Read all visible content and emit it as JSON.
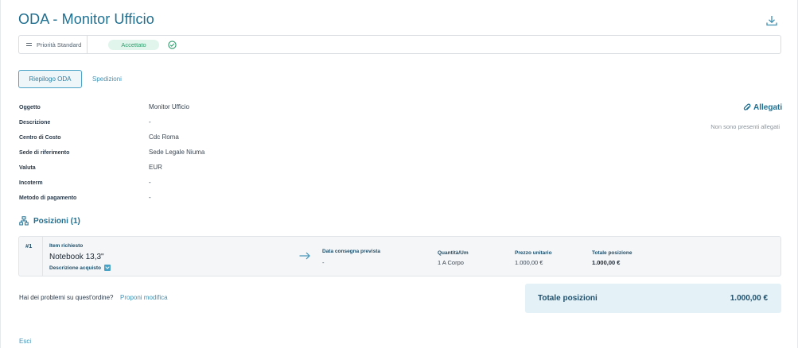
{
  "header": {
    "title": "ODA - Monitor Ufficio"
  },
  "status": {
    "priority_label": "Priorità Standard",
    "state_badge": "Accettato",
    "badge_color": "#2e9b6c"
  },
  "tabs": [
    {
      "label": "Riepilogo ODA",
      "active": true
    },
    {
      "label": "Spedizioni",
      "active": false
    }
  ],
  "details": [
    {
      "label": "Oggetto",
      "value": "Monitor Ufficio"
    },
    {
      "label": "Descrizione",
      "value": "-"
    },
    {
      "label": "Centro di Costo",
      "value": "Cdc Roma"
    },
    {
      "label": "Sede di riferimento",
      "value": "Sede Legale Niuma"
    },
    {
      "label": "Valuta",
      "value": "EUR"
    },
    {
      "label": "Incoterm",
      "value": "-"
    },
    {
      "label": "Metodo di pagamento",
      "value": "-"
    }
  ],
  "allegati": {
    "title": "Allegati",
    "empty_text": "Non sono presenti allegati"
  },
  "positions": {
    "title": "Posizioni (1)",
    "items": [
      {
        "number": "#1",
        "item_label": "Item richiesto",
        "item_name": "Notebook 13,3\"",
        "desc_link": "Descrizione acquisto",
        "delivery_label": "Data consegna prevista",
        "delivery_value": "-",
        "qty_label": "Quantità/Um",
        "qty_value": "1 A Corpo",
        "price_label": "Prezzo unitario",
        "price_value": "1.000,00 €",
        "total_label": "Totale posizione",
        "total_value": "1.000,00 €"
      }
    ]
  },
  "footer": {
    "help_text": "Hai dei problemi su quest'ordine?",
    "help_link": "Proponi modifica",
    "totale_label": "Totale posizioni",
    "totale_value": "1.000,00 €",
    "exit_link": "Esci"
  },
  "colors": {
    "accent": "#1f6f91",
    "link": "#3f94b8",
    "total_bg": "#e4f2f8"
  }
}
